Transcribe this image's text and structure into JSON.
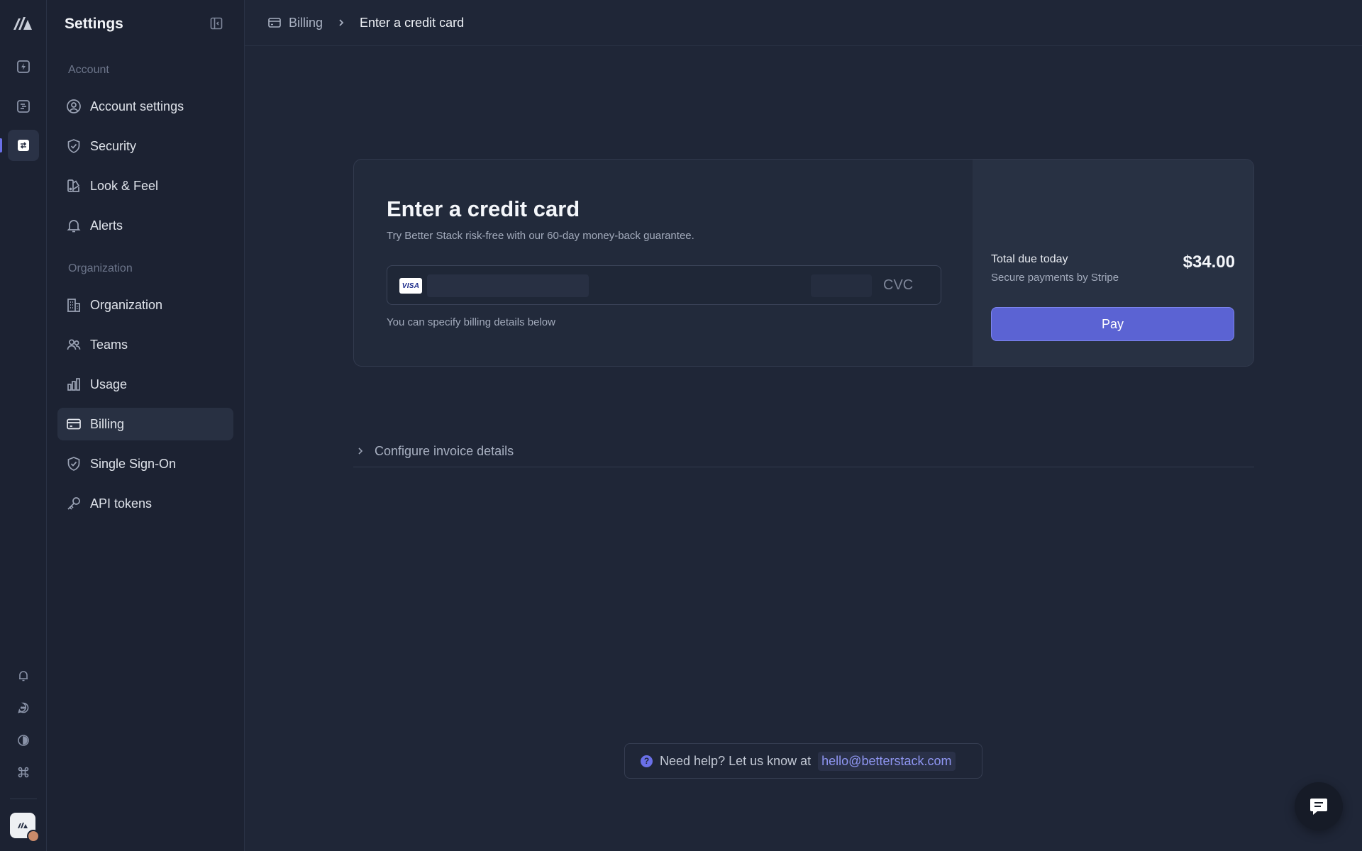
{
  "sidebar": {
    "title": "Settings",
    "sections": {
      "account": "Account",
      "organization": "Organization"
    },
    "items": [
      {
        "label": "Account settings",
        "icon": "user-circle-icon"
      },
      {
        "label": "Security",
        "icon": "shield-check-icon"
      },
      {
        "label": "Look & Feel",
        "icon": "palette-icon"
      },
      {
        "label": "Alerts",
        "icon": "bell-icon"
      },
      {
        "label": "Organization",
        "icon": "building-icon"
      },
      {
        "label": "Teams",
        "icon": "users-icon"
      },
      {
        "label": "Usage",
        "icon": "bar-chart-icon"
      },
      {
        "label": "Billing",
        "icon": "credit-card-icon",
        "active": true
      },
      {
        "label": "Single Sign-On",
        "icon": "shield-check-icon"
      },
      {
        "label": "API tokens",
        "icon": "key-icon"
      }
    ]
  },
  "breadcrumb": {
    "parent": "Billing",
    "current": "Enter a credit card"
  },
  "card": {
    "title": "Enter a credit card",
    "subtitle": "Try Better Stack risk-free with our 60-day money-back guarantee.",
    "card_brand": "VISA",
    "cvc_placeholder": "CVC",
    "note": "You can specify billing details below",
    "total_label": "Total due today",
    "total_sub": "Secure payments by Stripe",
    "total_amount": "$34.00",
    "pay_label": "Pay"
  },
  "invoice": {
    "label": "Configure invoice details"
  },
  "help": {
    "text": "Need help? Let us know at",
    "email": "hello@betterstack.com"
  },
  "colors": {
    "background": "#1f2637",
    "sidebar": "#1c2232",
    "accent": "#5b63d3",
    "link": "#8f96f2"
  }
}
